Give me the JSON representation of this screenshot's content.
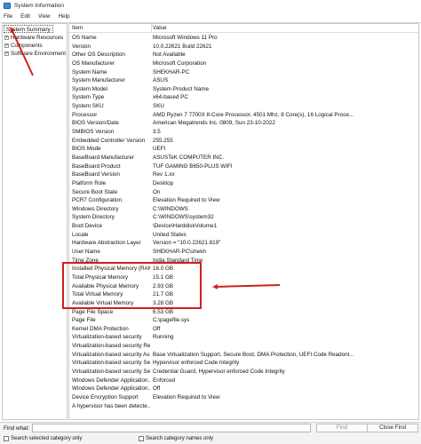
{
  "window": {
    "title": "System Information"
  },
  "menu": [
    "File",
    "Edit",
    "View",
    "Help"
  ],
  "tree": {
    "items": [
      {
        "label": "System Summary",
        "expander": ""
      },
      {
        "label": "Hardware Resources",
        "expander": "+"
      },
      {
        "label": "Components",
        "expander": "+"
      },
      {
        "label": "Software Environment",
        "expander": "+"
      }
    ]
  },
  "table": {
    "headers": {
      "item": "Item",
      "value": "Value"
    },
    "rows": [
      [
        "OS Name",
        "Microsoft Windows 11 Pro"
      ],
      [
        "Version",
        "10.0.22621 Build 22621"
      ],
      [
        "Other OS Description",
        "Not Available"
      ],
      [
        "OS Manufacturer",
        "Microsoft Corporation"
      ],
      [
        "System Name",
        "SHEKHAR-PC"
      ],
      [
        "System Manufacturer",
        "ASUS"
      ],
      [
        "System Model",
        "System Product Name"
      ],
      [
        "System Type",
        "x64-based PC"
      ],
      [
        "System SKU",
        "SKU"
      ],
      [
        "Processor",
        "AMD Ryzen 7 7700X 8-Core Processor, 4501 Mhz, 8 Core(s), 16 Logical Proce..."
      ],
      [
        "BIOS Version/Date",
        "American Megatrends Inc. 0809, Sun 23-10-2022"
      ],
      [
        "SMBIOS Version",
        "3.5"
      ],
      [
        "Embedded Controller Version",
        "255.255"
      ],
      [
        "BIOS Mode",
        "UEFI"
      ],
      [
        "BaseBoard Manufacturer",
        "ASUSTeK COMPUTER INC."
      ],
      [
        "BaseBoard Product",
        "TUF GAMING B650-PLUS WIFI"
      ],
      [
        "BaseBoard Version",
        "Rev 1.xx"
      ],
      [
        "Platform Role",
        "Desktop"
      ],
      [
        "Secure Boot State",
        "On"
      ],
      [
        "PCR7 Configuration",
        "Elevation Required to View"
      ],
      [
        "Windows Directory",
        "C:\\WINDOWS"
      ],
      [
        "System Directory",
        "C:\\WINDOWS\\system32"
      ],
      [
        "Boot Device",
        "\\Device\\HarddiskVolume1"
      ],
      [
        "Locale",
        "United States"
      ],
      [
        "Hardware Abstraction Layer",
        "Version = \"10.0.22621.819\""
      ],
      [
        "User Name",
        "SHEKHAR-PC\\shekh"
      ],
      [
        "Time Zone",
        "India Standard Time"
      ],
      [
        "Installed Physical Memory (RAM)",
        "16.0 GB"
      ],
      [
        "Total Physical Memory",
        "15.1 GB"
      ],
      [
        "Available Physical Memory",
        "2.93 GB"
      ],
      [
        "Total Virtual Memory",
        "21.7 GB"
      ],
      [
        "Available Virtual Memory",
        "3.28 GB"
      ],
      [
        "Page File Space",
        "6.53 GB"
      ],
      [
        "Page File",
        "C:\\pagefile.sys"
      ],
      [
        "Kernel DMA Protection",
        "Off"
      ],
      [
        "Virtualization-based security",
        "Running"
      ],
      [
        "Virtualization-based security Re...",
        ""
      ],
      [
        "Virtualization-based security Av...",
        "Base Virtualization Support, Secure Boot, DMA Protection, UEFI Code Readonl..."
      ],
      [
        "Virtualization-based security Se...",
        "Hypervisor enforced Code Integrity"
      ],
      [
        "Virtualization-based security Se...",
        "Credential Guard, Hypervisor enforced Code Integrity"
      ],
      [
        "Windows Defender Application...",
        "Enforced"
      ],
      [
        "Windows Defender Application...",
        "Off"
      ],
      [
        "Device Encryption Support",
        "Elevation Required to View"
      ],
      [
        "A hypervisor has been detecte...",
        ""
      ]
    ]
  },
  "find": {
    "label": "Find what:",
    "value": "",
    "find_button": "Find",
    "close_button": "Close Find",
    "option_selected_only": "Search selected category only",
    "option_names_only": "Search category names only"
  },
  "annotations": {
    "color": "#d11f1f"
  }
}
